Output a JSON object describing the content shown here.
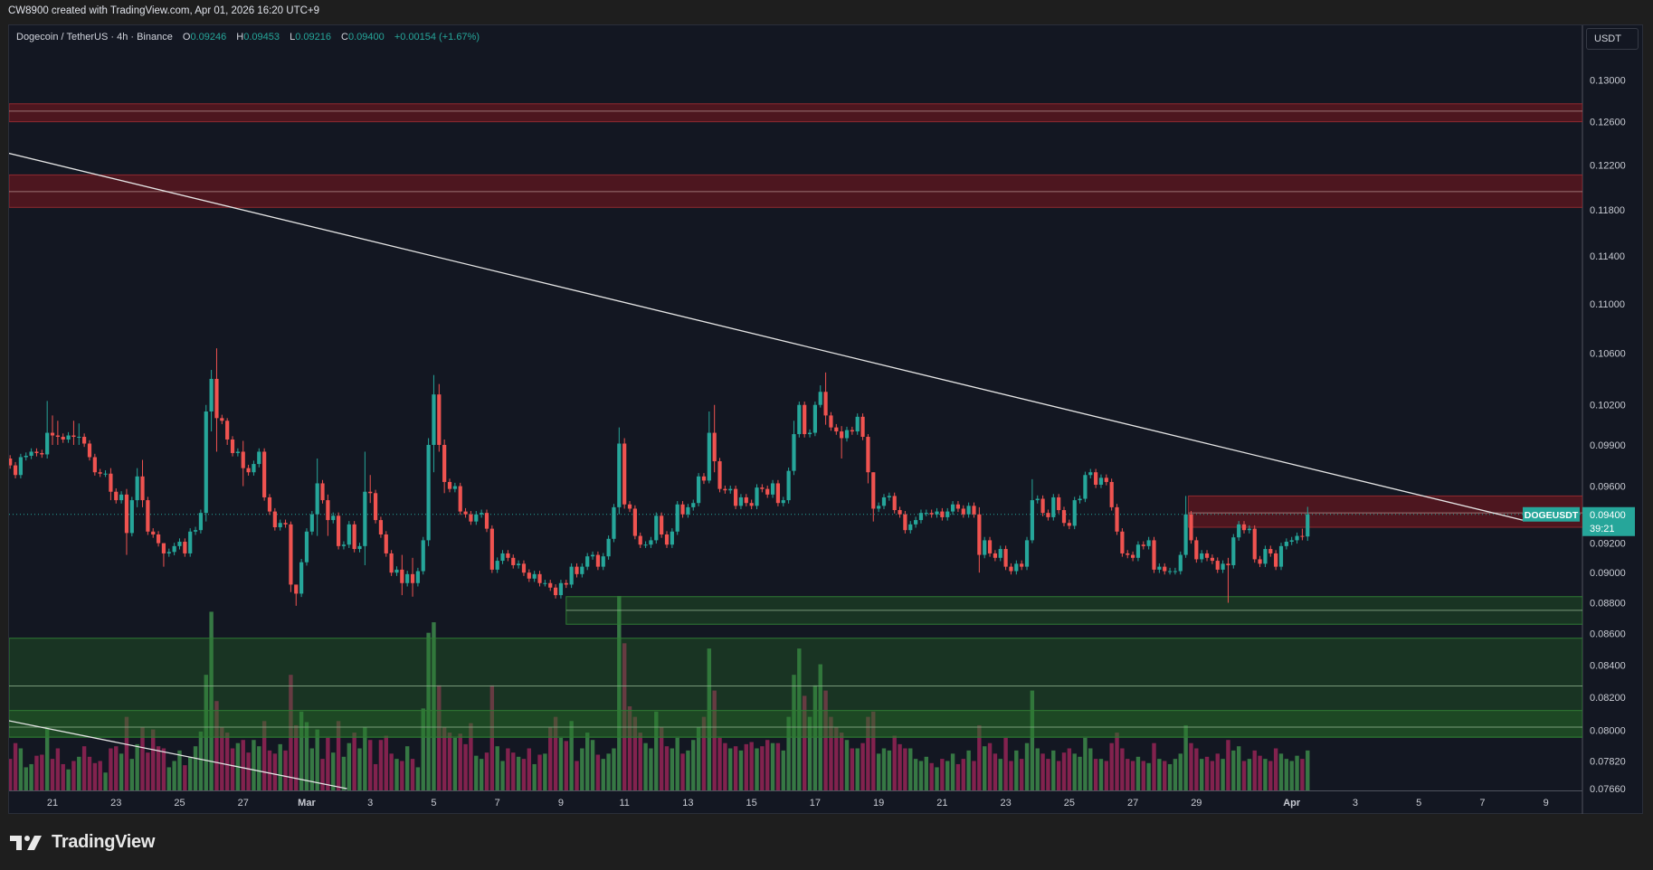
{
  "header": {
    "credit": "CW8900 created with TradingView.com, Apr 01, 2026 16:20 UTC+9"
  },
  "legend": {
    "symbol": "Dogecoin / TetherUS · 4h · Binance",
    "open_label": "O",
    "open": "0.09246",
    "high_label": "H",
    "high": "0.09453",
    "low_label": "L",
    "low": "0.09216",
    "close_label": "C",
    "close": "0.09400",
    "change": "+0.00154 (+1.67%)"
  },
  "price_axis": {
    "currency": "USDT"
  },
  "current_price": {
    "ticker": "DOGEUSDT",
    "price": "0.09400",
    "countdown": "39:21",
    "value": 0.094
  },
  "logo": {
    "text": "TradingView"
  },
  "colors": {
    "up": "#26a69a",
    "down": "#ef5350",
    "vol_up": "#3d8a4a",
    "vol_down": "#962456",
    "bg": "#131722"
  },
  "chart_data": {
    "type": "candlestick",
    "title": "Dogecoin / TetherUS · 4h · Binance",
    "scale": "log",
    "ylim": [
      0.0765,
      0.1354
    ],
    "first_candle_day": -1.333,
    "first_open": 0.098,
    "x_ticks": [
      {
        "label": "21",
        "day": 0
      },
      {
        "label": "23",
        "day": 2
      },
      {
        "label": "25",
        "day": 4
      },
      {
        "label": "27",
        "day": 6
      },
      {
        "label": "Mar",
        "day": 8,
        "bold": true
      },
      {
        "label": "3",
        "day": 10
      },
      {
        "label": "5",
        "day": 12
      },
      {
        "label": "7",
        "day": 14
      },
      {
        "label": "9",
        "day": 16
      },
      {
        "label": "11",
        "day": 18
      },
      {
        "label": "13",
        "day": 20
      },
      {
        "label": "15",
        "day": 22
      },
      {
        "label": "17",
        "day": 24
      },
      {
        "label": "19",
        "day": 26
      },
      {
        "label": "21",
        "day": 28
      },
      {
        "label": "23",
        "day": 30
      },
      {
        "label": "25",
        "day": 32
      },
      {
        "label": "27",
        "day": 34
      },
      {
        "label": "29",
        "day": 36
      },
      {
        "label": "Apr",
        "day": 39,
        "bold": true
      },
      {
        "label": "3",
        "day": 41
      },
      {
        "label": "5",
        "day": 43
      },
      {
        "label": "7",
        "day": 45
      },
      {
        "label": "9",
        "day": 47
      }
    ],
    "y_ticks": [
      {
        "label": "0.13000",
        "value": 0.13
      },
      {
        "label": "0.12600",
        "value": 0.126
      },
      {
        "label": "0.12200",
        "value": 0.122
      },
      {
        "label": "0.11800",
        "value": 0.118
      },
      {
        "label": "0.11400",
        "value": 0.114
      },
      {
        "label": "0.11000",
        "value": 0.11
      },
      {
        "label": "0.10600",
        "value": 0.106
      },
      {
        "label": "0.10200",
        "value": 0.102
      },
      {
        "label": "0.09900",
        "value": 0.099
      },
      {
        "label": "0.09600",
        "value": 0.096
      },
      {
        "label": "0.09200",
        "value": 0.092
      },
      {
        "label": "0.09000",
        "value": 0.09
      },
      {
        "label": "0.08800",
        "value": 0.088
      },
      {
        "label": "0.08600",
        "value": 0.086
      },
      {
        "label": "0.08400",
        "value": 0.084
      },
      {
        "label": "0.08200",
        "value": 0.082
      },
      {
        "label": "0.08000",
        "value": 0.08
      },
      {
        "label": "0.07820",
        "value": 0.0782
      },
      {
        "label": "0.07660",
        "value": 0.0766
      }
    ],
    "closes": [
      0.0975,
      0.0968,
      0.0981,
      0.0982,
      0.0985,
      0.0984,
      0.0983,
      0.0999,
      0.0997,
      0.0996,
      0.0994,
      0.0997,
      0.0996,
      0.0996,
      0.0991,
      0.0981,
      0.097,
      0.0969,
      0.0969,
      0.0956,
      0.095,
      0.0954,
      0.0927,
      0.095,
      0.0967,
      0.095,
      0.0928,
      0.0926,
      0.092,
      0.0913,
      0.0914,
      0.0918,
      0.0921,
      0.0913,
      0.0928,
      0.0929,
      0.0941,
      0.1015,
      0.104,
      0.101,
      0.1008,
      0.0994,
      0.0984,
      0.0985,
      0.0973,
      0.097,
      0.0976,
      0.0985,
      0.0952,
      0.0942,
      0.0931,
      0.0934,
      0.0933,
      0.0892,
      0.0886,
      0.0907,
      0.0928,
      0.094,
      0.0962,
      0.095,
      0.0936,
      0.0939,
      0.0918,
      0.0919,
      0.0933,
      0.0916,
      0.0918,
      0.0956,
      0.0955,
      0.0936,
      0.0926,
      0.0913,
      0.09,
      0.0902,
      0.0893,
      0.0899,
      0.0893,
      0.0901,
      0.0922,
      0.099,
      0.1028,
      0.099,
      0.0963,
      0.0958,
      0.096,
      0.0942,
      0.094,
      0.0935,
      0.094,
      0.0941,
      0.093,
      0.0902,
      0.0908,
      0.0913,
      0.091,
      0.0905,
      0.0906,
      0.09,
      0.0896,
      0.0899,
      0.0893,
      0.0893,
      0.089,
      0.0885,
      0.0893,
      0.0892,
      0.0904,
      0.0899,
      0.0904,
      0.0911,
      0.0912,
      0.0904,
      0.0911,
      0.0923,
      0.0945,
      0.0991,
      0.0947,
      0.0944,
      0.0925,
      0.0919,
      0.0919,
      0.0922,
      0.0939,
      0.0926,
      0.0919,
      0.0928,
      0.0947,
      0.094,
      0.0945,
      0.0948,
      0.0967,
      0.0964,
      0.0999,
      0.0978,
      0.0958,
      0.0957,
      0.0958,
      0.0946,
      0.0952,
      0.0948,
      0.0946,
      0.0959,
      0.0958,
      0.0954,
      0.0962,
      0.0948,
      0.095,
      0.0971,
      0.0998,
      0.102,
      0.0998,
      0.0999,
      0.102,
      0.103,
      0.1012,
      0.1003,
      0.1,
      0.0995,
      0.1001,
      0.1,
      0.1011,
      0.0996,
      0.097,
      0.0944,
      0.0946,
      0.0952,
      0.0953,
      0.0943,
      0.094,
      0.0929,
      0.0933,
      0.0936,
      0.0941,
      0.0941,
      0.094,
      0.0942,
      0.0938,
      0.0942,
      0.0947,
      0.0944,
      0.094,
      0.0946,
      0.094,
      0.0912,
      0.0922,
      0.0913,
      0.091,
      0.0916,
      0.0904,
      0.0901,
      0.0906,
      0.0904,
      0.0922,
      0.095,
      0.0951,
      0.0941,
      0.0938,
      0.0952,
      0.0943,
      0.0934,
      0.0932,
      0.095,
      0.0951,
      0.0968,
      0.097,
      0.0961,
      0.0966,
      0.0963,
      0.0945,
      0.0928,
      0.0913,
      0.0912,
      0.091,
      0.0919,
      0.0918,
      0.0922,
      0.0902,
      0.0904,
      0.0901,
      0.0901,
      0.0901,
      0.0912,
      0.094,
      0.0922,
      0.0909,
      0.0913,
      0.091,
      0.0908,
      0.0902,
      0.0906,
      0.0905,
      0.0924,
      0.0933,
      0.0929,
      0.093,
      0.0909,
      0.0906,
      0.0916,
      0.0913,
      0.0904,
      0.0918,
      0.0921,
      0.0922,
      0.0925,
      0.09246,
      0.094
    ],
    "wicks": [
      [
        7,
        0.1023,
        0.098
      ],
      [
        8,
        0.1012,
        0.099
      ],
      [
        9,
        0.1008,
        0.099
      ],
      [
        12,
        0.1008,
        0.099
      ],
      [
        13,
        0.1006,
        0.099
      ],
      [
        19,
        0.0973,
        0.095
      ],
      [
        22,
        0.0958,
        0.0912
      ],
      [
        24,
        0.0973,
        0.0945
      ],
      [
        25,
        0.0979,
        0.0945
      ],
      [
        29,
        0.092,
        0.0904
      ],
      [
        37,
        0.102,
        0.0935
      ],
      [
        38,
        0.1047,
        0.1
      ],
      [
        39,
        0.1064,
        0.0985
      ],
      [
        41,
        0.101,
        0.099
      ],
      [
        44,
        0.0993,
        0.096
      ],
      [
        53,
        0.0935,
        0.0887
      ],
      [
        54,
        0.0892,
        0.0878
      ],
      [
        58,
        0.098,
        0.0925
      ],
      [
        60,
        0.0954,
        0.0925
      ],
      [
        67,
        0.0985,
        0.0905
      ],
      [
        68,
        0.0968,
        0.0948
      ],
      [
        74,
        0.0912,
        0.0885
      ],
      [
        76,
        0.091,
        0.0884
      ],
      [
        79,
        0.0995,
        0.0918
      ],
      [
        80,
        0.1043,
        0.097
      ],
      [
        81,
        0.1036,
        0.0985
      ],
      [
        82,
        0.0994,
        0.0955
      ],
      [
        115,
        0.1003,
        0.094
      ],
      [
        116,
        0.0995,
        0.0944
      ],
      [
        132,
        0.1015,
        0.0962
      ],
      [
        133,
        0.102,
        0.097
      ],
      [
        148,
        0.1008,
        0.0968
      ],
      [
        153,
        0.1035,
        0.1018
      ],
      [
        154,
        0.1045,
        0.1005
      ],
      [
        157,
        0.1004,
        0.098
      ],
      [
        162,
        0.0998,
        0.0962
      ],
      [
        163,
        0.097,
        0.0935
      ],
      [
        183,
        0.0945,
        0.09
      ],
      [
        193,
        0.0965,
        0.092
      ],
      [
        222,
        0.0953,
        0.091
      ],
      [
        230,
        0.091,
        0.088
      ],
      [
        244,
        0.093,
        0.0922
      ],
      [
        245,
        0.09453,
        0.09216
      ]
    ],
    "volumes": [
      30,
      45,
      40,
      22,
      25,
      33,
      34,
      60,
      30,
      40,
      25,
      20,
      28,
      32,
      42,
      32,
      26,
      28,
      17,
      40,
      42,
      35,
      70,
      30,
      44,
      60,
      36,
      58,
      42,
      40,
      22,
      28,
      38,
      24,
      32,
      42,
      56,
      110,
      170,
      85,
      60,
      55,
      40,
      45,
      48,
      36,
      48,
      42,
      66,
      38,
      35,
      44,
      38,
      110,
      62,
      75,
      65,
      40,
      58,
      30,
      50,
      36,
      66,
      32,
      45,
      55,
      40,
      60,
      48,
      25,
      48,
      52,
      35,
      30,
      28,
      42,
      30,
      22,
      78,
      150,
      160,
      100,
      60,
      55,
      50,
      54,
      44,
      64,
      33,
      30,
      36,
      100,
      42,
      28,
      40,
      36,
      32,
      30,
      40,
      25,
      34,
      35,
      60,
      70,
      50,
      47,
      66,
      28,
      40,
      55,
      48,
      34,
      30,
      35,
      40,
      185,
      140,
      80,
      70,
      55,
      45,
      40,
      75,
      60,
      42,
      40,
      50,
      35,
      38,
      48,
      60,
      70,
      135,
      95,
      50,
      45,
      40,
      42,
      38,
      44,
      46,
      40,
      42,
      48,
      45,
      45,
      38,
      70,
      110,
      135,
      90,
      70,
      100,
      120,
      95,
      70,
      60,
      55,
      48,
      40,
      40,
      45,
      70,
      75,
      35,
      40,
      38,
      52,
      44,
      40,
      40,
      30,
      28,
      32,
      26,
      22,
      30,
      28,
      35,
      25,
      30,
      38,
      28,
      62,
      42,
      45,
      35,
      30,
      50,
      28,
      38,
      30,
      45,
      95,
      40,
      35,
      30,
      38,
      28,
      36,
      40,
      35,
      32,
      50,
      40,
      30,
      30,
      28,
      45,
      55,
      40,
      30,
      28,
      32,
      28,
      26,
      45,
      30,
      28,
      25,
      30,
      35,
      62,
      45,
      40,
      30,
      32,
      28,
      35,
      30,
      48,
      38,
      42,
      28,
      30,
      38,
      33,
      30,
      28,
      40,
      35,
      30,
      28,
      33,
      30,
      38
    ],
    "volume_max": 185,
    "zones": [
      {
        "name": "resistance-zone-upper",
        "kind": "supply",
        "start_index": null,
        "top": 0.1277,
        "bottom": 0.126,
        "mid": 0.127
      },
      {
        "name": "resistance-zone-middle",
        "kind": "supply",
        "start_index": null,
        "top": 0.1211,
        "bottom": 0.1182,
        "mid": 0.1196
      },
      {
        "name": "resistance-zone-current",
        "kind": "supply",
        "start_index": 222.5,
        "top": 0.0953,
        "bottom": 0.0931,
        "mid": 0.0941
      },
      {
        "name": "support-zone-near",
        "kind": "demand",
        "start_index": 105,
        "top": 0.0884,
        "bottom": 0.0866,
        "mid": 0.0875
      },
      {
        "name": "support-zone-wide",
        "kind": "demand",
        "start_index": null,
        "top": 0.0857,
        "bottom": 0.0796,
        "mid": 0.0827
      },
      {
        "name": "support-zone-inner",
        "kind": "demand",
        "start_index": null,
        "top": 0.0812,
        "bottom": 0.0796,
        "mid": 0.0802
      }
    ],
    "trendlines": [
      {
        "name": "descending-trendline",
        "from": {
          "index": -0.5,
          "price": 0.1231
        },
        "to": {
          "index": 285.6,
          "price": 0.0936
        }
      },
      {
        "name": "lower-trendline",
        "from": {
          "index": -0.5,
          "price": 0.0806
        },
        "to": {
          "index": 63.6,
          "price": 0.0766
        }
      }
    ]
  }
}
